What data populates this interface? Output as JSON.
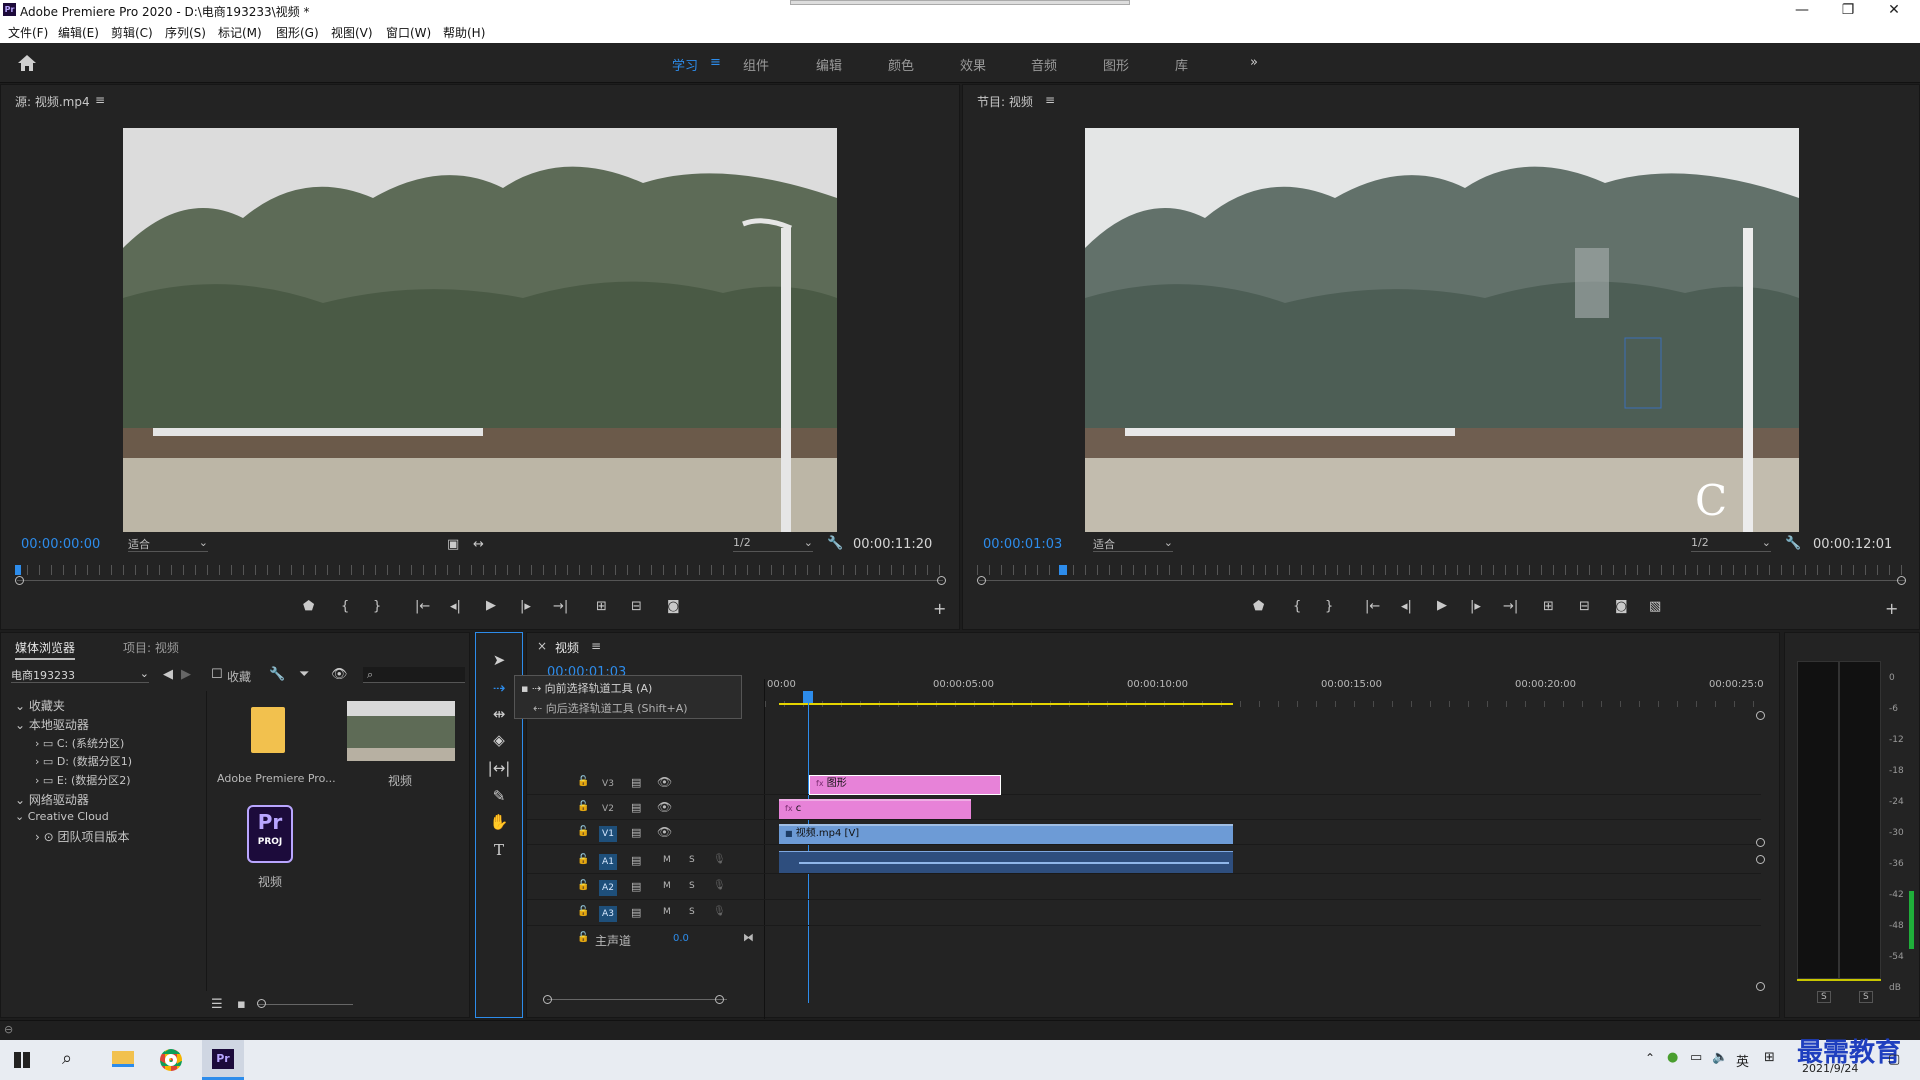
{
  "app": {
    "title": "Adobe Premiere Pro 2020 - D:\\电商193233\\视频 *",
    "logo": "Pr"
  },
  "menu": [
    "文件(F)",
    "编辑(E)",
    "剪辑(C)",
    "序列(S)",
    "标记(M)",
    "图形(G)",
    "视图(V)",
    "窗口(W)",
    "帮助(H)"
  ],
  "workspaces": [
    "学习",
    "组件",
    "编辑",
    "颜色",
    "效果",
    "音频",
    "图形",
    "库"
  ],
  "workspace_overflow": "»",
  "source": {
    "title": "源: 视频.mp4",
    "timecode": "00:00:00:00",
    "fit": "适合",
    "resolution": "1/2",
    "duration": "00:00:11:20"
  },
  "program": {
    "title": "节目: 视频",
    "timecode": "00:00:01:03",
    "fit": "适合",
    "resolution": "1/2",
    "duration": "00:00:12:01",
    "overlay_text": "C"
  },
  "media_browser": {
    "tab": "媒体浏览器",
    "project_tab": "项目: 视频",
    "location": "电商193233",
    "collect_label": "收藏",
    "tree": [
      {
        "label": "收藏夹",
        "level": 0
      },
      {
        "label": "本地驱动器",
        "level": 0
      },
      {
        "label": "C: (系统分区)",
        "level": 1
      },
      {
        "label": "D: (数据分区1)",
        "level": 1
      },
      {
        "label": "E: (数据分区2)",
        "level": 1
      },
      {
        "label": "网络驱动器",
        "level": 0
      },
      {
        "label": "Creative Cloud",
        "level": 0
      },
      {
        "label": "团队项目版本",
        "level": 1
      }
    ],
    "items": [
      {
        "label": "Adobe Premiere Pro..."
      },
      {
        "label": "视频"
      },
      {
        "label": "视频"
      }
    ],
    "proj_badge": "PROJ"
  },
  "tooltip": {
    "item1": "向前选择轨道工具 (A)",
    "item2": "向后选择轨道工具 (Shift+A)"
  },
  "timeline": {
    "tab": "视频",
    "timecode": "00:00:01:03",
    "ruler": [
      "00:00",
      "00:00:05:00",
      "00:00:10:00",
      "00:00:15:00",
      "00:00:20:00",
      "00:00:25:0"
    ],
    "tracks": [
      "V3",
      "V2",
      "V1",
      "A1",
      "A2",
      "A3"
    ],
    "clips": {
      "graphic": "图形",
      "c": "c",
      "video": "视频.mp4 [V]"
    },
    "master": "主声道",
    "master_value": "0.0",
    "mute": "M",
    "solo": "S"
  },
  "meter": {
    "scale": [
      "0",
      "-6",
      "-12",
      "-18",
      "-24",
      "-30",
      "-36",
      "-42",
      "-48",
      "-54",
      "dB"
    ],
    "solo_labels": [
      "S",
      "S"
    ]
  },
  "taskbar": {
    "ime": "英",
    "date": "2021/9/24",
    "watermark": "最需教育"
  }
}
